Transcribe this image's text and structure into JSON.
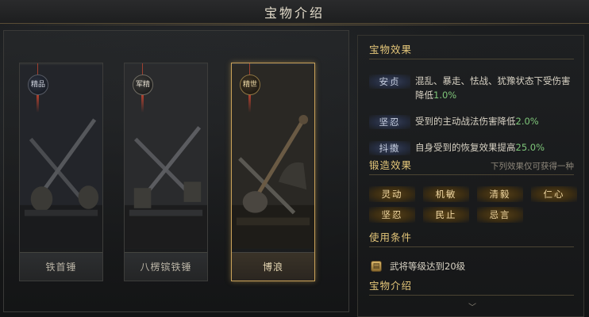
{
  "window": {
    "title": "宝物介绍"
  },
  "treasures": [
    {
      "name": "铁首锤",
      "tag": "精品",
      "tag_style": "blue",
      "selected": false
    },
    {
      "name": "八楞镔铁锤",
      "tag": "军精",
      "tag_style": "gray",
      "selected": false
    },
    {
      "name": "博浪",
      "tag": "精世",
      "tag_style": "gold",
      "selected": true
    }
  ],
  "panel": {
    "effects_title": "宝物效果",
    "effects": [
      {
        "badge": "安贞",
        "text_before": "混乱、暴走、怯战、犹豫状态下受伤害降低",
        "value": "1.0%",
        "text_after": ""
      },
      {
        "badge": "坚忍",
        "text_before": "受到的主动战法伤害降低",
        "value": "2.0%",
        "text_after": ""
      },
      {
        "badge": "抖擞",
        "text_before": "自身受到的恢复效果提高",
        "value": "25.0%",
        "text_after": ""
      }
    ],
    "forge_title": "锻造效果",
    "forge_note": "下列效果仅可获得一种",
    "forge_options": [
      "灵动",
      "机敏",
      "清毅",
      "仁心",
      "坚忍",
      "民止",
      "忌言"
    ],
    "conditions_title": "使用条件",
    "condition_text": "武将等级达到20级",
    "intro_title": "宝物介绍"
  },
  "colors": {
    "accent_gold": "#e5c77a",
    "highlight_green": "#7fc77a",
    "selected_border": "#c9a25a"
  },
  "icons": {
    "condition": "level-scroll-icon",
    "scroll": "chevron-down-icon"
  }
}
